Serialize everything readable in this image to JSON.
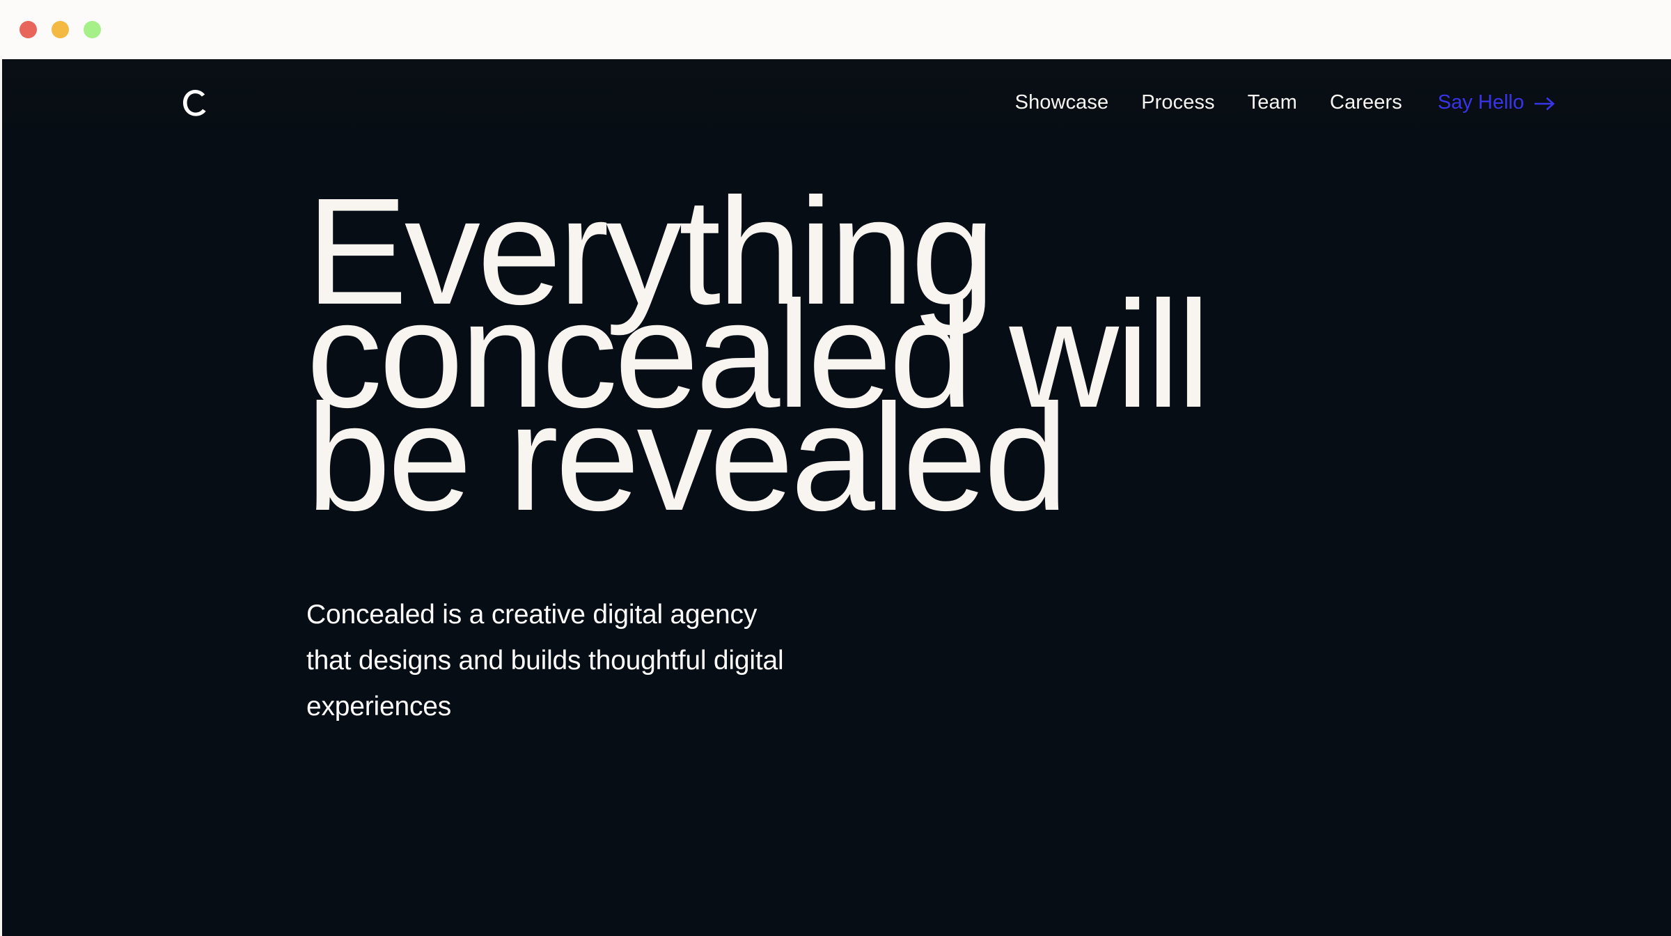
{
  "window": {
    "traffic_lights": [
      {
        "name": "close",
        "color": "#e7655a"
      },
      {
        "name": "minimize",
        "color": "#f4b942"
      },
      {
        "name": "zoom",
        "color": "#a6f089"
      }
    ]
  },
  "theme": {
    "chrome_bg": "#fcfbf9",
    "page_bg": "#060d14",
    "heading_color": "#f8f5f0",
    "nav_color": "#f7f5f2",
    "accent": "#3a34e8",
    "subtitle_color": "#fdfdfd"
  },
  "header": {
    "logo": {
      "icon": "concealed-c-logo",
      "label": "C"
    },
    "nav": [
      {
        "label": "Showcase"
      },
      {
        "label": "Process"
      },
      {
        "label": "Team"
      },
      {
        "label": "Careers"
      }
    ],
    "cta": {
      "label": "Say Hello",
      "icon": "arrow-right-icon"
    }
  },
  "hero": {
    "title_lines": [
      "Everything",
      "concealed will",
      "be revealed"
    ],
    "subtitle_lines": [
      "Concealed is a creative digital agency",
      "that designs and builds thoughtful digital",
      "experiences"
    ]
  }
}
